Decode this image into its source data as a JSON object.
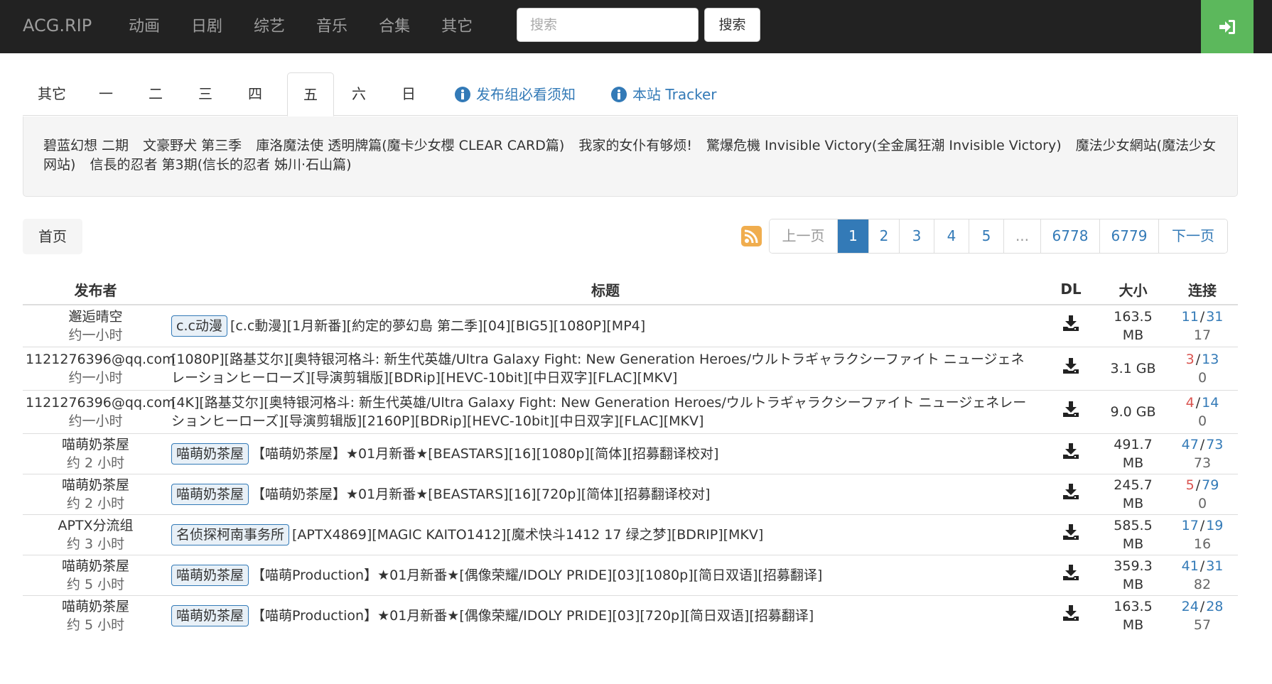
{
  "navbar": {
    "brand": "ACG.RIP",
    "links": [
      "动画",
      "日剧",
      "综艺",
      "音乐",
      "合集",
      "其它"
    ],
    "search_placeholder": "搜索",
    "search_button": "搜索",
    "login_icon": "sign-in-icon",
    "accent_color": "#5cb85c"
  },
  "tabs": {
    "items": [
      "其它",
      "一",
      "二",
      "三",
      "四",
      "五",
      "六",
      "日"
    ],
    "active": "五",
    "info_links": [
      "发布组必看须知",
      "本站 Tracker"
    ],
    "info_icon": "info-circle-icon"
  },
  "well": {
    "shows": [
      "碧蓝幻想 二期",
      "文豪野犬 第三季",
      "庫洛魔法使 透明牌篇(魔卡少女櫻 CLEAR CARD篇)",
      "我家的女仆有够烦!",
      "驚爆危機 Invisible Victory(全金属狂潮 Invisible Victory)",
      "魔法少女網站(魔法少女网站)",
      "信長的忍者 第3期(信长的忍者 姊川·石山篇)"
    ]
  },
  "breadcrumb": {
    "home": "首页"
  },
  "pagination": {
    "rss_icon": "rss-icon",
    "prev": "上一页",
    "pages": [
      "1",
      "2",
      "3",
      "4",
      "5",
      "...",
      "6778",
      "6779"
    ],
    "current": "1",
    "next": "下一页"
  },
  "table": {
    "headers": {
      "publisher": "发布者",
      "title": "标题",
      "dl": "DL",
      "size": "大小",
      "conn": "连接"
    },
    "download_icon": "download-icon",
    "rows": [
      {
        "publisher": "邂逅晴空",
        "time": "约一小时",
        "tag": "c.c动漫",
        "title": "[c.c動漫][1月新番][約定的夢幻島 第二季][04][BIG5][1080P][MP4]",
        "size": "163.5 MB",
        "seeders": "11",
        "leechers": "31",
        "completed": "17",
        "seed_red": false
      },
      {
        "publisher": "1121276396@qq.com",
        "time": "约一小时",
        "tag": "",
        "title": "[1080P][路基艾尔][奥特银河格斗: 新生代英雄/Ultra Galaxy Fight: New Generation Heroes/ウルトラギャラクシーファイト ニュージェネレーションヒーローズ][导演剪辑版][BDRip][HEVC-10bit][中日双字][FLAC][MKV]",
        "size": "3.1 GB",
        "seeders": "3",
        "leechers": "13",
        "completed": "0",
        "seed_red": true
      },
      {
        "publisher": "1121276396@qq.com",
        "time": "约一小时",
        "tag": "",
        "title": "[4K][路基艾尔][奥特银河格斗: 新生代英雄/Ultra Galaxy Fight: New Generation Heroes/ウルトラギャラクシーファイト ニュージェネレーションヒーローズ][导演剪辑版][2160P][BDRip][HEVC-10bit][中日双字][FLAC][MKV]",
        "size": "9.0 GB",
        "seeders": "4",
        "leechers": "14",
        "completed": "0",
        "seed_red": true
      },
      {
        "publisher": "喵萌奶茶屋",
        "time": "约 2 小时",
        "tag": "喵萌奶茶屋",
        "title": "【喵萌奶茶屋】★01月新番★[BEASTARS][16][1080p][简体][招募翻译校对]",
        "size": "491.7 MB",
        "seeders": "47",
        "leechers": "73",
        "completed": "73",
        "seed_red": false
      },
      {
        "publisher": "喵萌奶茶屋",
        "time": "约 2 小时",
        "tag": "喵萌奶茶屋",
        "title": "【喵萌奶茶屋】★01月新番★[BEASTARS][16][720p][简体][招募翻译校对]",
        "size": "245.7 MB",
        "seeders": "5",
        "leechers": "79",
        "completed": "0",
        "seed_red": true
      },
      {
        "publisher": "APTX分流组",
        "time": "约 3 小时",
        "tag": "名侦探柯南事务所",
        "title": "[APTX4869][MAGIC KAITO1412][魔术快斗1412 17 绿之梦][BDRIP][MKV]",
        "size": "585.5 MB",
        "seeders": "17",
        "leechers": "19",
        "completed": "16",
        "seed_red": false
      },
      {
        "publisher": "喵萌奶茶屋",
        "time": "约 5 小时",
        "tag": "喵萌奶茶屋",
        "title": "【喵萌Production】★01月新番★[偶像荣耀/IDOLY PRIDE][03][1080p][简日双语][招募翻译]",
        "size": "359.3 MB",
        "seeders": "41",
        "leechers": "31",
        "completed": "82",
        "seed_red": false
      },
      {
        "publisher": "喵萌奶茶屋",
        "time": "约 5 小时",
        "tag": "喵萌奶茶屋",
        "title": "【喵萌Production】★01月新番★[偶像荣耀/IDOLY PRIDE][03][720p][简日双语][招募翻译]",
        "size": "163.5 MB",
        "seeders": "24",
        "leechers": "28",
        "completed": "57",
        "seed_red": false
      }
    ]
  }
}
